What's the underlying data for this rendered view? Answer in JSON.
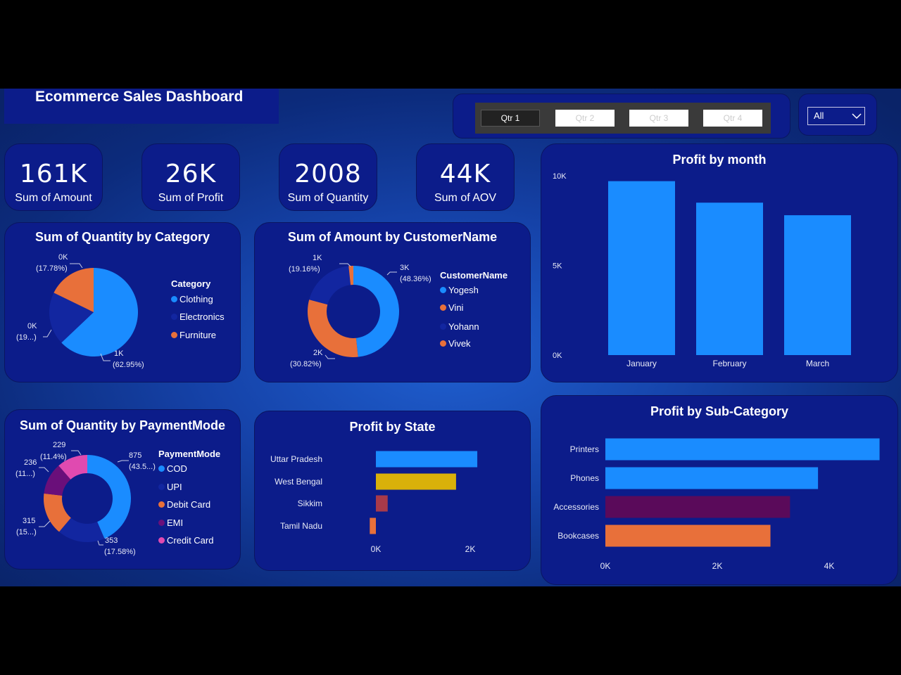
{
  "title": "Ecommerce Sales Dashboard",
  "quarter_slicer": {
    "items": [
      "Qtr 1",
      "Qtr 2",
      "Qtr 3",
      "Qtr 4"
    ],
    "selected": "Qtr 1"
  },
  "dropdown": {
    "value": "All"
  },
  "kpis": [
    {
      "value": "161K",
      "label": "Sum of Amount"
    },
    {
      "value": "26K",
      "label": "Sum of Profit"
    },
    {
      "value": "2008",
      "label": "Sum of Quantity"
    },
    {
      "value": "44K",
      "label": "Sum of AOV"
    }
  ],
  "chart_data": [
    {
      "id": "qty_category",
      "type": "pie",
      "title": "Sum of Quantity by Category",
      "legend_title": "Category",
      "legend_position": "right",
      "slices": [
        {
          "name": "Clothing",
          "percent": 62.95,
          "color": "#1a8cff",
          "label_value": "1K",
          "label_pct": "(62.95%)"
        },
        {
          "name": "Electronics",
          "percent": 19.3,
          "color": "#1226a0",
          "label_value": "0K",
          "label_pct": "(19...)"
        },
        {
          "name": "Furniture",
          "percent": 17.78,
          "color": "#e8703a",
          "label_value": "0K",
          "label_pct": "(17.78%)"
        }
      ]
    },
    {
      "id": "amount_customer",
      "type": "donut",
      "title": "Sum of Amount by CustomerName",
      "legend_title": "CustomerName",
      "legend_position": "right",
      "slices": [
        {
          "name": "Yogesh",
          "percent": 48.36,
          "color": "#1a8cff",
          "label_value": "3K",
          "label_pct": "(48.36%)"
        },
        {
          "name": "Vini",
          "percent": 30.82,
          "color": "#e8703a",
          "label_value": "2K",
          "label_pct": "(30.82%)"
        },
        {
          "name": "Yohann",
          "percent": 19.16,
          "color": "#1226a0",
          "label_value": "1K",
          "label_pct": "(19.16%)"
        },
        {
          "name": "Vivek",
          "percent": 1.66,
          "color": "#e8703a",
          "label_value": "",
          "label_pct": ""
        }
      ]
    },
    {
      "id": "profit_month",
      "type": "bar",
      "title": "Profit by month",
      "categories": [
        "January",
        "February",
        "March"
      ],
      "values": [
        9700,
        8500,
        7800
      ],
      "yticks": [
        "0K",
        "5K",
        "10K"
      ],
      "ylim": [
        0,
        10000
      ],
      "color": "#1a8cff"
    },
    {
      "id": "qty_payment",
      "type": "donut",
      "title": "Sum of Quantity by PaymentMode",
      "legend_title": "PaymentMode",
      "legend_position": "right",
      "slices": [
        {
          "name": "COD",
          "value": 875,
          "color": "#1a8cff",
          "label_value": "875",
          "label_pct": "(43.5...)"
        },
        {
          "name": "UPI",
          "value": 353,
          "color": "#1226a0",
          "label_value": "353",
          "label_pct": "(17.58%)"
        },
        {
          "name": "Debit Card",
          "value": 315,
          "color": "#e8703a",
          "label_value": "315",
          "label_pct": "(15...)"
        },
        {
          "name": "EMI",
          "value": 236,
          "color": "#6a0f7a",
          "label_value": "236",
          "label_pct": "(11...)"
        },
        {
          "name": "Credit Card",
          "value": 229,
          "color": "#e04ab0",
          "label_value": "229",
          "label_pct": "(11.4%)"
        }
      ]
    },
    {
      "id": "profit_state",
      "type": "bar",
      "orientation": "horizontal",
      "title": "Profit by State",
      "categories": [
        "Uttar Pradesh",
        "West Bengal",
        "Sikkim",
        "Tamil Nadu"
      ],
      "values": [
        2150,
        1700,
        250,
        -130
      ],
      "colors": [
        "#1a8cff",
        "#d9b10a",
        "#a83a4a",
        "#e8703a"
      ],
      "xticks": [
        "0K",
        "2K"
      ],
      "xlim": [
        0,
        2000
      ]
    },
    {
      "id": "profit_subcat",
      "type": "bar",
      "orientation": "horizontal",
      "title": "Profit by Sub-Category",
      "categories": [
        "Printers",
        "Phones",
        "Accessories",
        "Bookcases"
      ],
      "values": [
        4900,
        3800,
        3300,
        2950
      ],
      "colors": [
        "#1a8cff",
        "#1a8cff",
        "#5a0a5a",
        "#e8703a"
      ],
      "xticks": [
        "0K",
        "2K",
        "4K"
      ],
      "xlim": [
        0,
        4000
      ]
    }
  ]
}
